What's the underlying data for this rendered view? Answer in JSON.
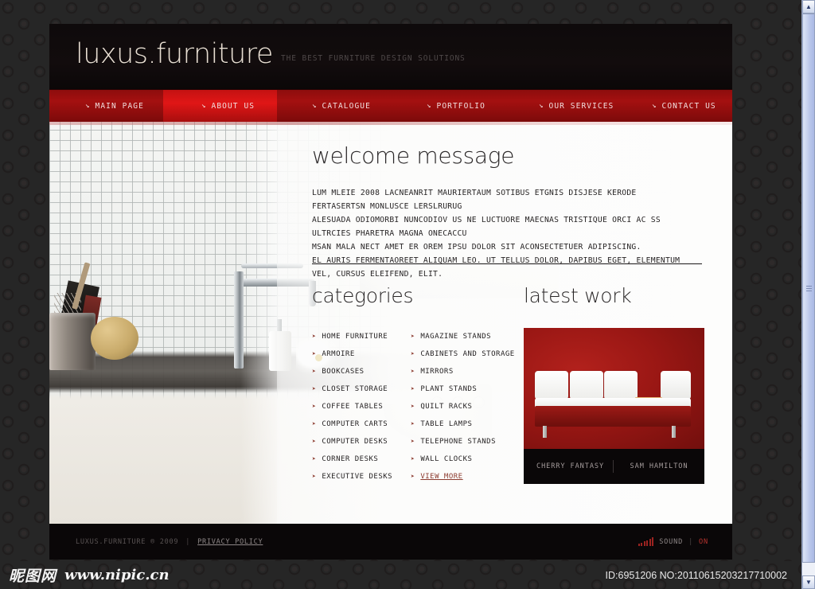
{
  "brand": {
    "logo": "luxus.furniture",
    "tagline": "THE BEST FURNITURE DESIGN SOLUTIONS",
    "accent_red": "#a41010",
    "active_red": "#e01616",
    "dark": "#0a0607"
  },
  "nav": {
    "icon": "arrow-down-right-icon",
    "items": [
      {
        "label": "MAIN PAGE",
        "active": false
      },
      {
        "label": "ABOUT US",
        "active": true
      },
      {
        "label": "CATALOGUE",
        "active": false
      },
      {
        "label": "PORTFOLIO",
        "active": false
      },
      {
        "label": "OUR SERVICES",
        "active": false
      },
      {
        "label": "CONTACT US",
        "active": false
      }
    ]
  },
  "welcome": {
    "title": "welcome message",
    "lines": [
      "LUM MLEIE 2008 LACNEANRIT MAURIERTAUM SOTIBUS ETGNIS DISJESE KERODE FERTASERTSN MONLUSCE LERSLRURUG",
      "ALESUADA ODIOMORBI NUNCODIOV US NE LUCTUORE MAECNAS TRISTIQUE ORCI AC SS ULTRCIES PHARETRA MAGNA ONECACCU",
      "MSAN MALA NECT AMET ER OREM IPSU DOLOR SIT ACONSECTETUER ADIPISCING.",
      "EL AURIS FERMENTAOREET ALIQUAM LEO. UT TELLUS DOLOR, DAPIBUS EGET, ELEMENTUM VEL, CURSUS ELEIFEND, ELIT."
    ]
  },
  "categories": {
    "title": "categories",
    "bullet": "arrow-right-icon",
    "column_left": [
      "HOME FURNITURE",
      "ARMOIRE",
      "BOOKCASES",
      "CLOSET STORAGE",
      "COFFEE TABLES",
      "COMPUTER CARTS",
      "COMPUTER DESKS",
      "CORNER DESKS",
      "EXECUTIVE DESKS"
    ],
    "column_right": [
      "MAGAZINE STANDS",
      "CABINETS AND STORAGE",
      "MIRRORS",
      "PLANT STANDS",
      "QUILT RACKS",
      "TABLE LAMPS",
      "TELEPHONE STANDS",
      "WALL CLOCKS",
      "VIEW MORE"
    ],
    "view_more_label": "VIEW MORE"
  },
  "latest_work": {
    "title": "latest work",
    "project_name": "CHERRY FANTASY",
    "author": "SAM HAMILTON",
    "image_alt": "red-room-white-sofa-photo"
  },
  "footer": {
    "copyright": "LUXUS.FURNITURE ® 2009",
    "separator": "|",
    "privacy_label": "PRIVACY POLICY",
    "sound_label": "SOUND",
    "sound_separator": "|",
    "sound_state": "ON",
    "equalizer_icon": "sound-bars-icon"
  },
  "watermark": {
    "site_cn": "昵图网",
    "site_url": "www.nipic.cn",
    "id_text": "ID:6951206 NO:20110615203217710002"
  },
  "scrollbar": {
    "up_icon": "chevron-up-icon",
    "down_icon": "chevron-down-icon"
  }
}
